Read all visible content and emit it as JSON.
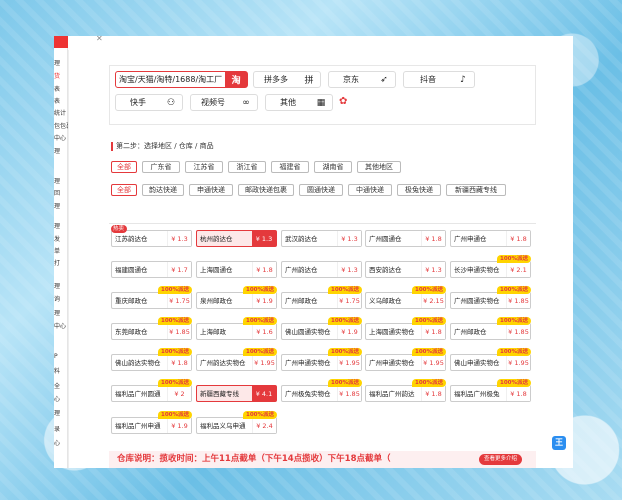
{
  "sidebar": {
    "top_label": "•",
    "items": [
      "理",
      "货",
      "表",
      "表",
      "统计",
      "包包裹",
      "中心",
      "理",
      "理",
      "回",
      "理",
      "理",
      "发",
      "单",
      "打",
      "理",
      "询",
      "理",
      "中心",
      "P",
      "料",
      "全",
      "心",
      "理",
      "录",
      "心"
    ]
  },
  "platforms": [
    {
      "label": "淘宝/天猫/淘特/1688/淘工厂",
      "icon": "淘",
      "active": true
    },
    {
      "label": "拼多多",
      "icon": "拼",
      "active": false
    },
    {
      "label": "京东",
      "icon": "➶",
      "active": false
    },
    {
      "label": "抖音",
      "icon": "♪",
      "active": false
    },
    {
      "label": "快手",
      "icon": "⚇",
      "active": false
    },
    {
      "label": "视频号",
      "icon": "∞",
      "active": false
    },
    {
      "label": "其他",
      "icon": "▦",
      "active": false
    }
  ],
  "step_title": "第二步：选择地区 / 仓库 / 商品",
  "regions": [
    {
      "label": "全部",
      "active": true
    },
    {
      "label": "广东省",
      "active": false
    },
    {
      "label": "江苏省",
      "active": false
    },
    {
      "label": "浙江省",
      "active": false
    },
    {
      "label": "福建省",
      "active": false
    },
    {
      "label": "湖南省",
      "active": false
    },
    {
      "label": "其他地区",
      "active": false
    }
  ],
  "couriers": [
    {
      "label": "全部",
      "active": true
    },
    {
      "label": "韵达快递",
      "active": false
    },
    {
      "label": "申通快递",
      "active": false
    },
    {
      "label": "邮政快递包裹",
      "active": false
    },
    {
      "label": "圆通快递",
      "active": false
    },
    {
      "label": "中通快递",
      "active": false
    },
    {
      "label": "极兔快递",
      "active": false
    },
    {
      "label": "新疆西藏专线",
      "active": false
    }
  ],
  "warehouses": [
    {
      "name": "江苏韵达仓",
      "price": "¥ 1.3",
      "badge": "",
      "hot": "热卖",
      "active": false
    },
    {
      "name": "杭州韵达仓",
      "price": "¥ 1.3",
      "badge": "",
      "hot": "",
      "active": true
    },
    {
      "name": "武汉韵达仓",
      "price": "¥ 1.3",
      "badge": "",
      "hot": "",
      "active": false
    },
    {
      "name": "广州圆通仓",
      "price": "¥ 1.8",
      "badge": "",
      "hot": "",
      "active": false
    },
    {
      "name": "广州申通仓",
      "price": "¥ 1.8",
      "badge": "",
      "hot": "",
      "active": false
    },
    {
      "name": "福建圆通仓",
      "price": "¥ 1.7",
      "badge": "",
      "hot": "",
      "active": false
    },
    {
      "name": "上海圆通仓",
      "price": "¥ 1.8",
      "badge": "",
      "hot": "",
      "active": false
    },
    {
      "name": "广州韵达仓",
      "price": "¥ 1.3",
      "badge": "",
      "hot": "",
      "active": false
    },
    {
      "name": "西安韵达仓",
      "price": "¥ 1.3",
      "badge": "",
      "hot": "",
      "active": false
    },
    {
      "name": "长沙申通实物仓",
      "price": "¥ 2.1",
      "badge": "100%派送",
      "hot": "",
      "active": false
    },
    {
      "name": "重庆邮政仓",
      "price": "¥ 1.75",
      "badge": "100%派送",
      "hot": "",
      "active": false
    },
    {
      "name": "泉州邮政仓",
      "price": "¥ 1.9",
      "badge": "100%派送",
      "hot": "",
      "active": false
    },
    {
      "name": "广州邮政仓",
      "price": "¥ 1.75",
      "badge": "100%派送",
      "hot": "",
      "active": false
    },
    {
      "name": "义乌邮政仓",
      "price": "¥ 2.15",
      "badge": "100%派送",
      "hot": "",
      "active": false
    },
    {
      "name": "广州圆通实物仓",
      "price": "¥ 1.85",
      "badge": "100%派送",
      "hot": "",
      "active": false
    },
    {
      "name": "东莞邮政仓",
      "price": "¥ 1.85",
      "badge": "100%派送",
      "hot": "",
      "active": false
    },
    {
      "name": "上海邮政",
      "price": "¥ 1.6",
      "badge": "100%派送",
      "hot": "",
      "active": false
    },
    {
      "name": "佛山圆通实物仓",
      "price": "¥ 1.9",
      "badge": "100%派送",
      "hot": "",
      "active": false
    },
    {
      "name": "上海圆通实物仓",
      "price": "¥ 1.8",
      "badge": "100%派送",
      "hot": "",
      "active": false
    },
    {
      "name": "广州邮政仓",
      "price": "¥ 1.85",
      "badge": "100%派送",
      "hot": "",
      "active": false
    },
    {
      "name": "佛山韵达实物仓",
      "price": "¥ 1.8",
      "badge": "100%派送",
      "hot": "",
      "active": false
    },
    {
      "name": "广州韵达实物仓",
      "price": "¥ 1.95",
      "badge": "100%派送",
      "hot": "",
      "active": false
    },
    {
      "name": "广州申通实物仓",
      "price": "¥ 1.95",
      "badge": "100%派送",
      "hot": "",
      "active": false
    },
    {
      "name": "广州申通实物仓",
      "price": "¥ 1.95",
      "badge": "100%派送",
      "hot": "",
      "active": false
    },
    {
      "name": "佛山申通实物仓",
      "price": "¥ 1.95",
      "badge": "100%派送",
      "hot": "",
      "active": false
    },
    {
      "name": "福利品广州圆通",
      "price": "¥ 2",
      "badge": "100%派送",
      "hot": "",
      "active": false
    },
    {
      "name": "新疆西藏专线",
      "price": "¥ 4.1",
      "badge": "",
      "hot": "",
      "active": true
    },
    {
      "name": "广州极兔实物仓",
      "price": "¥ 1.85",
      "badge": "100%派送",
      "hot": "",
      "active": false
    },
    {
      "name": "福利品广州韵达",
      "price": "¥ 1.8",
      "badge": "100%派送",
      "hot": "",
      "active": false
    },
    {
      "name": "福利品广州极兔",
      "price": "¥ 1.8",
      "badge": "100%派送",
      "hot": "",
      "active": false
    },
    {
      "name": "福利品广州申通",
      "price": "¥ 1.9",
      "badge": "100%派送",
      "hot": "",
      "active": false
    },
    {
      "name": "福利品义乌申通",
      "price": "¥ 2.4",
      "badge": "100%派送",
      "hot": "",
      "active": false
    }
  ],
  "notice": "仓库说明：揽收时间：上午11点截单（下午14点揽收）下午18点截单（",
  "more_button": "查看更多介绍",
  "side_badge": "王",
  "colors": {
    "accent": "#e4393c",
    "badge": "#ffd400"
  }
}
